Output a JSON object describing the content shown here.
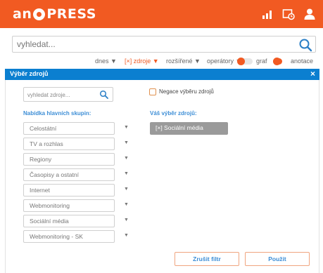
{
  "header": {
    "logo_left": "an",
    "logo_right": "PRESS",
    "icons": [
      "signal-bars-icon",
      "clock-window-icon",
      "user-icon"
    ],
    "accent_color": "#f15a22"
  },
  "search": {
    "placeholder": "vyhledat...",
    "icon": "search-icon"
  },
  "filter_bar": {
    "items": [
      "dnes ▼",
      "[×] zdroje ▼",
      "rozšířené ▼",
      "operátory ▼"
    ],
    "active_item": "[×] zdroje ▼",
    "graf_label": "graf",
    "graf_on": true,
    "anotace_label": "anotace",
    "anotace_on": true
  },
  "modal": {
    "title": "Výběr zdrojů",
    "close_label": "×",
    "header_color": "#0b7fd0",
    "source_search_placeholder": "vyhledat zdroje...",
    "negation_label": "Negace výběru zdrojů",
    "negation_checked": false,
    "groups_title": "Nabídka hlavních skupin:",
    "groups": [
      {
        "label": "Celostátní",
        "arrow": "▼"
      },
      {
        "label": "TV a rozhlas",
        "arrow": "▼"
      },
      {
        "label": "Regiony",
        "arrow": "▼"
      },
      {
        "label": "Časopisy a ostatní",
        "arrow": "▼"
      },
      {
        "label": "Internet",
        "arrow": "▼"
      },
      {
        "label": "Webmonitoring",
        "arrow": "▼"
      },
      {
        "label": "Sociální média",
        "arrow": "▼"
      },
      {
        "label": "Webmonitoring - SK",
        "arrow": "▼"
      }
    ],
    "selection_title": "Váš výběr zdrojů:",
    "selected": [
      "[×] Sociální média"
    ],
    "cancel_button": "Zrušit filtr",
    "apply_button": "Použít"
  }
}
